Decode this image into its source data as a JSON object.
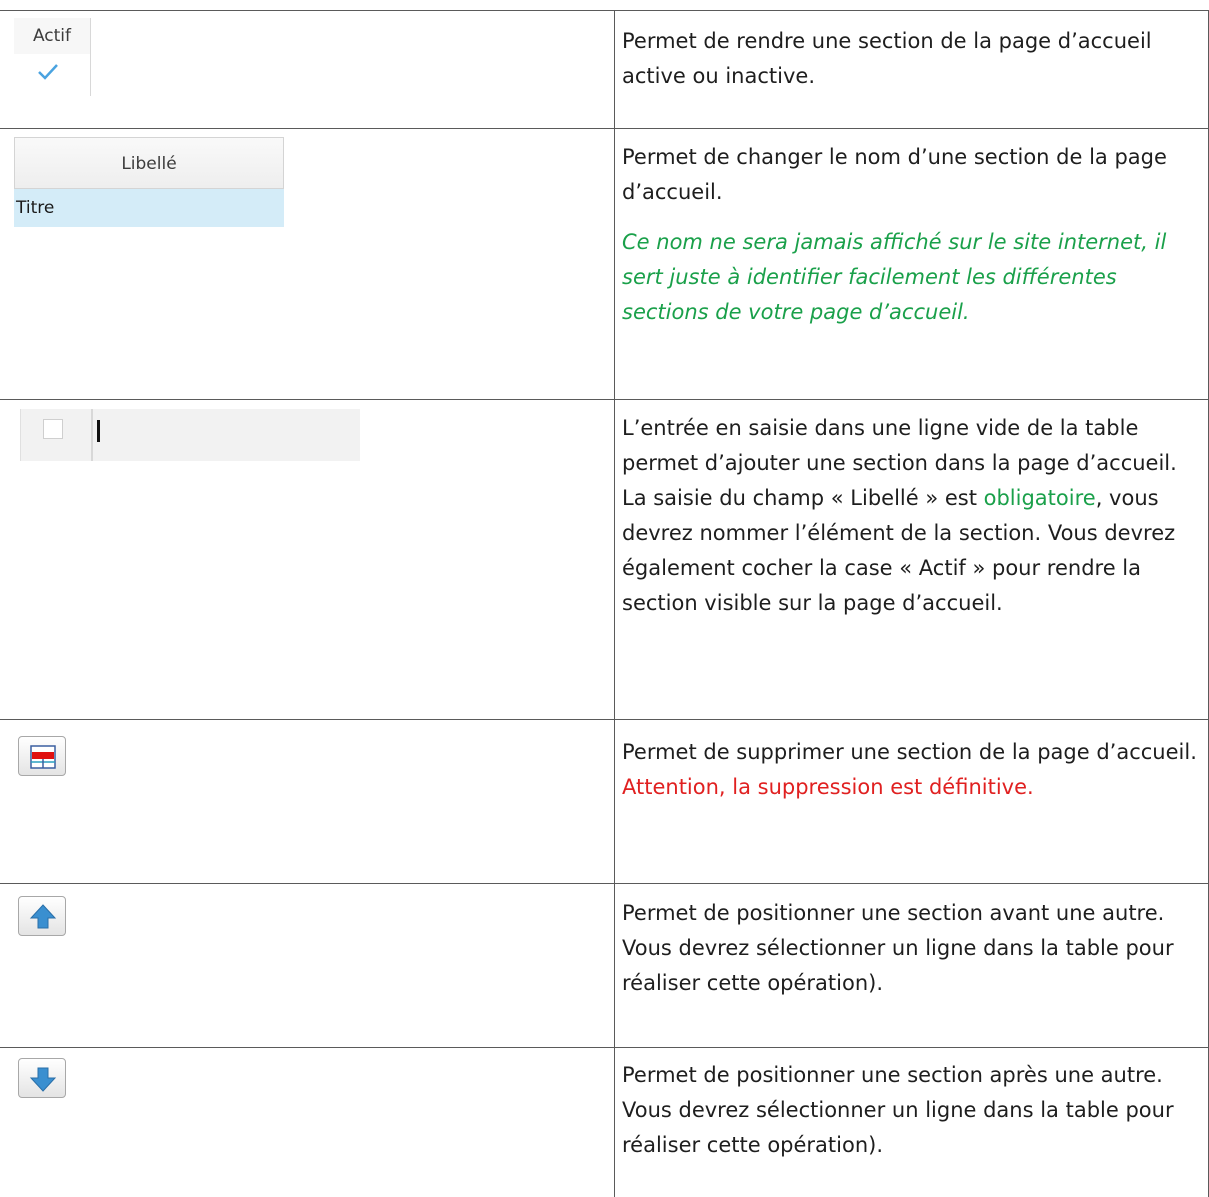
{
  "rows": [
    {
      "widget": {
        "header": "Actif",
        "checked": true
      },
      "description": [
        "Permet de rendre une section de la page d’accueil active ou inactive."
      ]
    },
    {
      "widget": {
        "header": "Libellé",
        "value": "Titre"
      },
      "description": [
        "Permet de changer le nom d’une section de la page d’accueil."
      ],
      "note": "Ce nom ne sera jamais affiché sur le site internet, il sert juste à identifier facilement les différentes sections de votre page d’accueil."
    },
    {
      "widget": {
        "checked": false
      },
      "description_parts": {
        "before": "L’entrée en saisie dans une ligne vide de la table permet d’ajouter une section dans la page d’accueil. La saisie du champ « Libellé » est ",
        "highlight": "obligatoire",
        "after": ", vous devrez nommer l’élément de la section. Vous devrez également cocher la case « Actif » pour rendre la section visible sur la page d’accueil."
      }
    },
    {
      "widget": {
        "icon": "delete-row-icon"
      },
      "description": [
        "Permet de supprimer une section de la page d’accueil."
      ],
      "warning": "Attention, la suppression est définitive."
    },
    {
      "widget": {
        "icon": "arrow-up-icon"
      },
      "description": [
        "Permet de positionner une section avant une autre. Vous devrez sélectionner un ligne dans la table pour réaliser cette opération)."
      ]
    },
    {
      "widget": {
        "icon": "arrow-down-icon"
      },
      "description": [
        "Permet de positionner une section après une autre. Vous devrez sélectionner un ligne dans la table pour réaliser cette opération)."
      ]
    }
  ],
  "colors": {
    "note": "#1aa04a",
    "warning": "#e02020",
    "selected_row": "#d4ecf8",
    "arrow": "#3a8fd0"
  }
}
